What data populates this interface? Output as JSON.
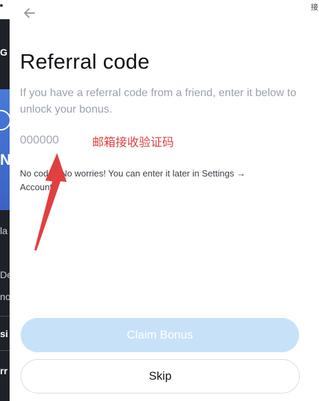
{
  "modal": {
    "title": "Referral code",
    "description": "If you have a referral code from a friend, enter it below to unlock your bonus.",
    "code_placeholder": "000000",
    "hint": "No code? No worries! You can enter it later in Settings → Account.",
    "claim_label": "Claim Bonus",
    "skip_label": "Skip",
    "back_icon": "arrow-left-icon"
  },
  "annotation": {
    "text": "邮箱接收验证码",
    "color": "#e0403f"
  },
  "background": {
    "fragments": [
      "G",
      "N",
      "la",
      "De",
      "no",
      "si",
      "rr"
    ],
    "right_text": "接"
  },
  "colors": {
    "claim_disabled": "#c7e2f8",
    "title": "#111418",
    "muted": "#9aa1ab"
  }
}
